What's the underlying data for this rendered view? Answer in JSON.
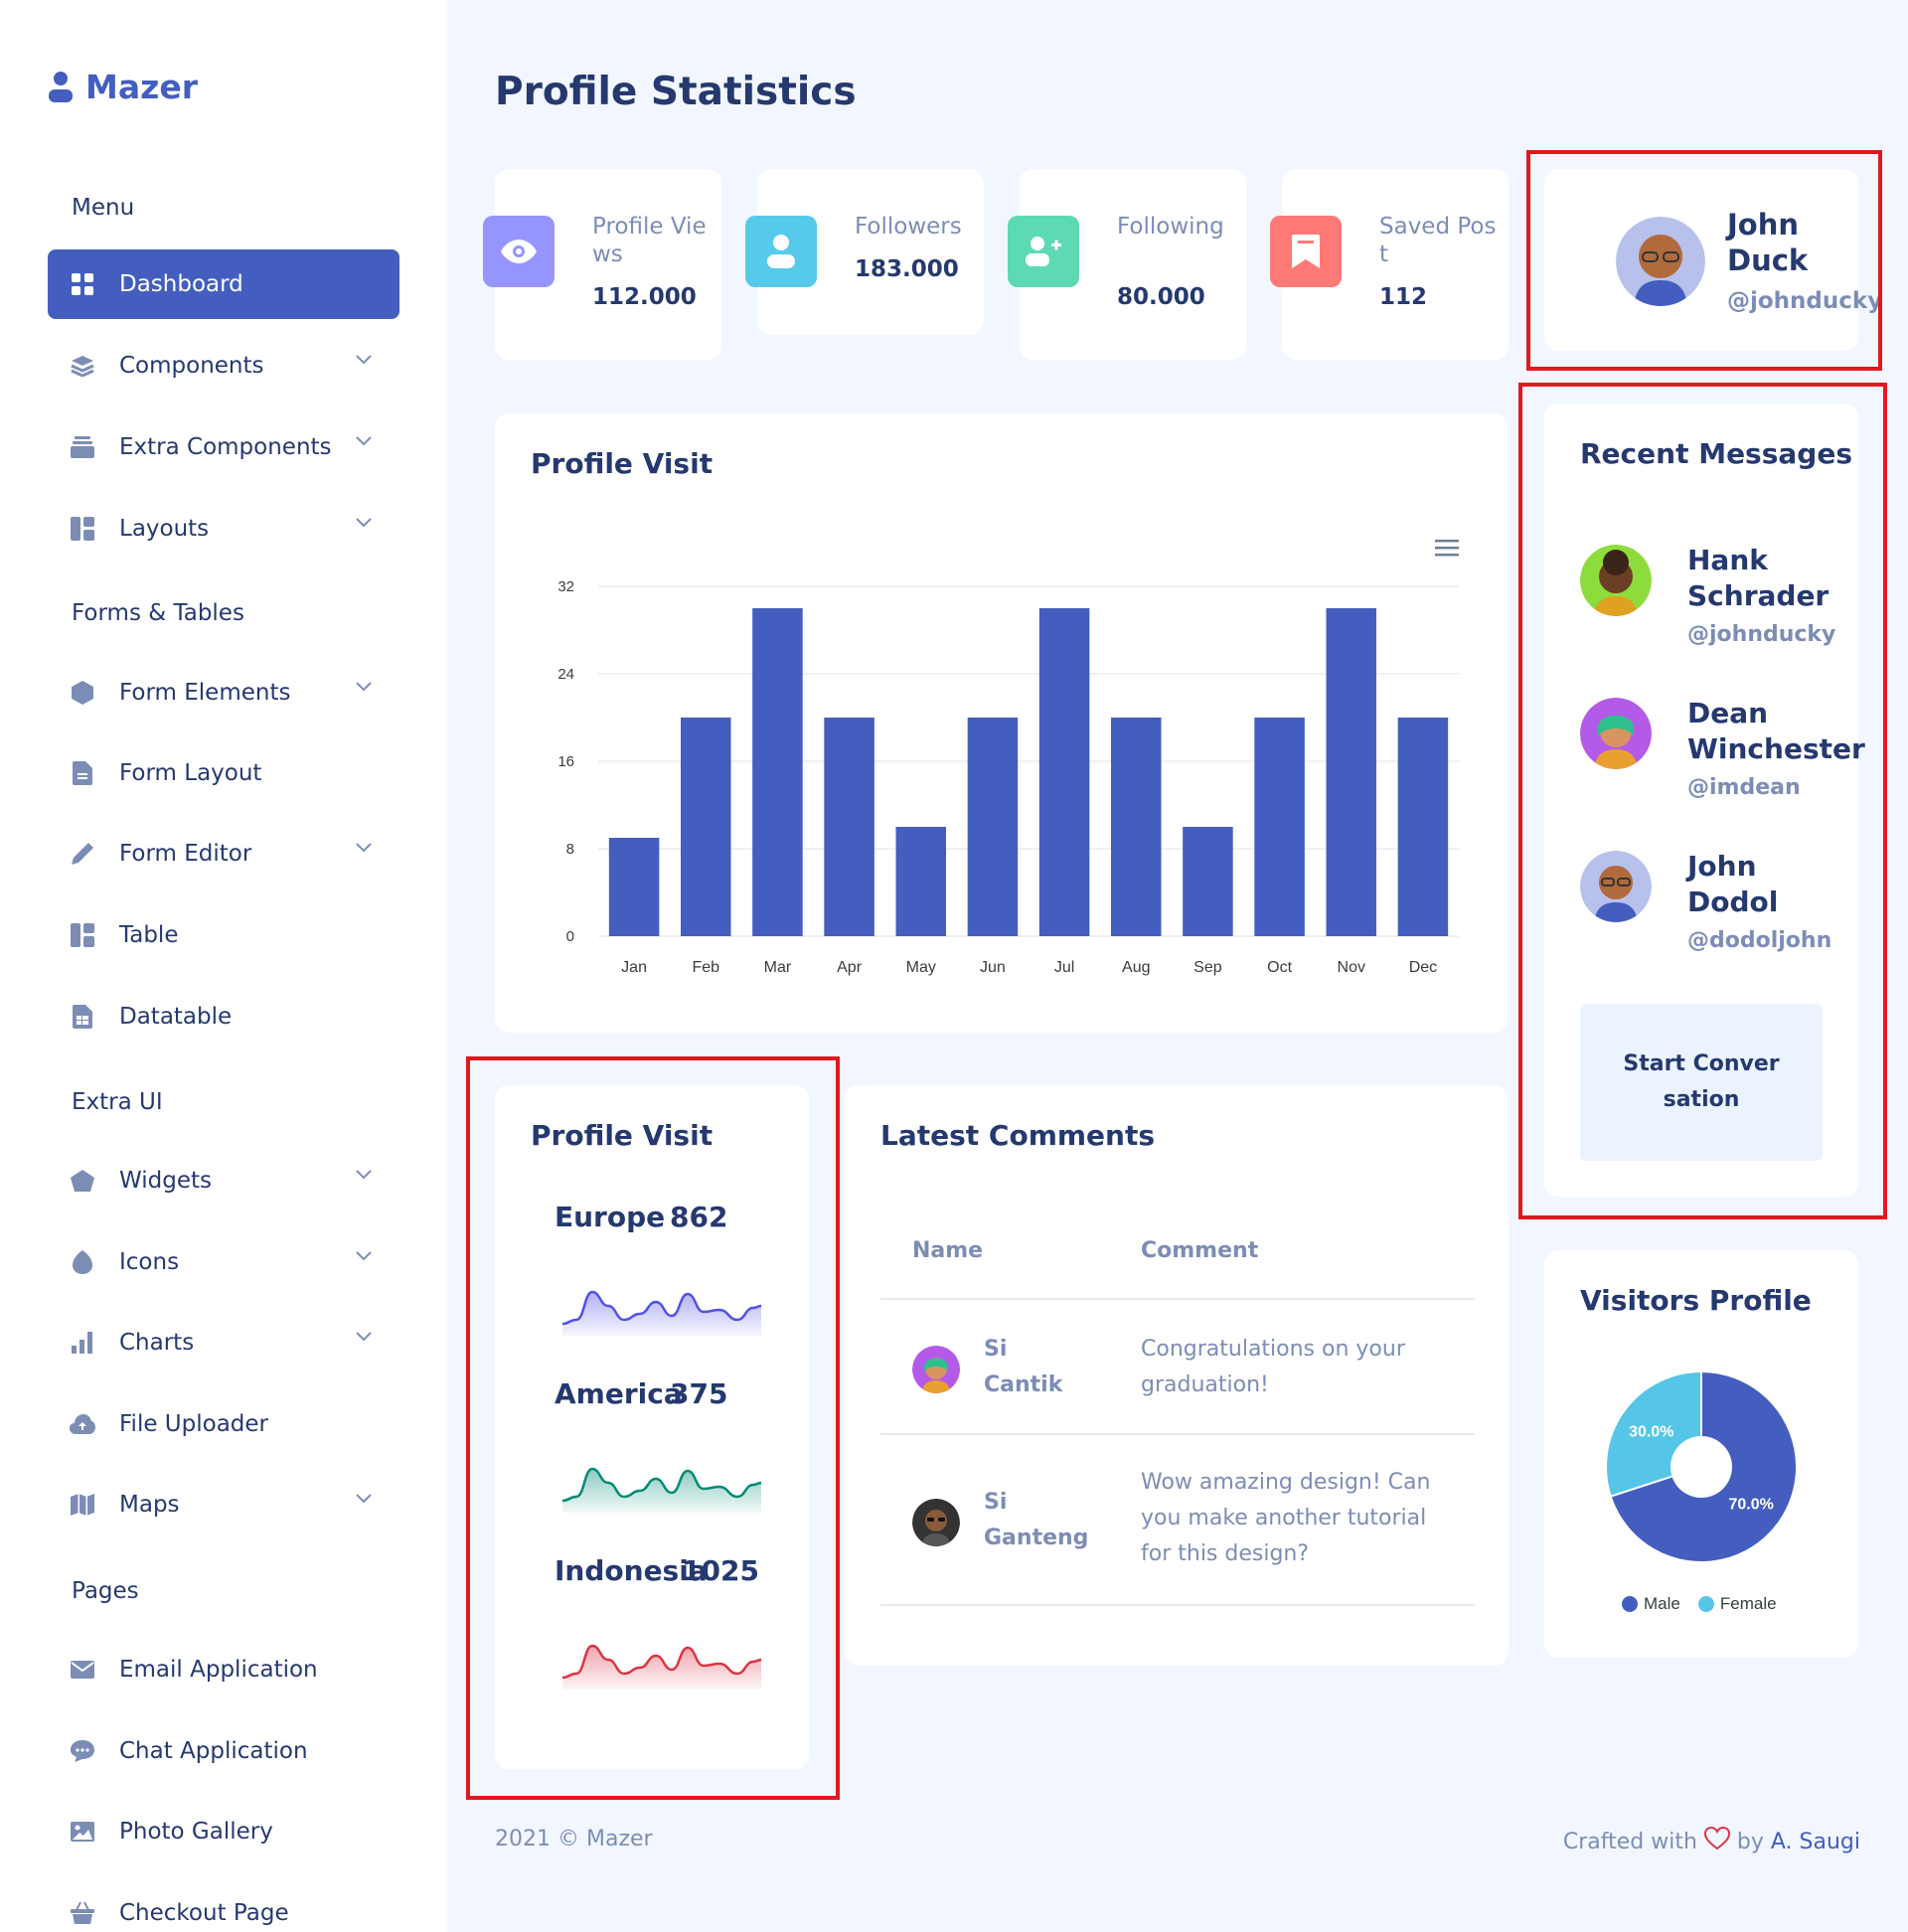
{
  "sidebar": {
    "logo": "Mazer",
    "sections": {
      "menu": "Menu",
      "forms": "Forms & Tables",
      "extra": "Extra UI",
      "pages": "Pages"
    },
    "items": [
      {
        "label": "Dashboard",
        "icon": "grid-icon"
      },
      {
        "label": "Components",
        "icon": "stack-icon"
      },
      {
        "label": "Extra Components",
        "icon": "collection-icon"
      },
      {
        "label": "Layouts",
        "icon": "layout-icon"
      },
      {
        "label": "Form Elements",
        "icon": "hexagon-icon"
      },
      {
        "label": "Form Layout",
        "icon": "file-text-icon"
      },
      {
        "label": "Form Editor",
        "icon": "pen-icon"
      },
      {
        "label": "Table",
        "icon": "table-icon"
      },
      {
        "label": "Datatable",
        "icon": "spreadsheet-icon"
      },
      {
        "label": "Widgets",
        "icon": "pentagon-icon"
      },
      {
        "label": "Icons",
        "icon": "egg-icon"
      },
      {
        "label": "Charts",
        "icon": "bar-chart-icon"
      },
      {
        "label": "File Uploader",
        "icon": "cloud-upload-icon"
      },
      {
        "label": "Maps",
        "icon": "map-icon"
      },
      {
        "label": "Email Application",
        "icon": "envelope-icon"
      },
      {
        "label": "Chat Application",
        "icon": "chat-icon"
      },
      {
        "label": "Photo Gallery",
        "icon": "image-icon"
      },
      {
        "label": "Checkout Page",
        "icon": "basket-icon"
      }
    ]
  },
  "header": {
    "title": "Profile Statistics"
  },
  "stats": [
    {
      "label": "Profile Views",
      "value": "112.000",
      "color": "#9694ff",
      "icon": "eye-icon"
    },
    {
      "label": "Followers",
      "value": "183.000",
      "color": "#57caeb",
      "icon": "person-icon"
    },
    {
      "label": "Following",
      "value": "80.000",
      "color": "#5ddab4",
      "icon": "person-plus-icon"
    },
    {
      "label": "Saved Post",
      "value": "112",
      "color": "#ff7976",
      "icon": "bookmark-icon"
    }
  ],
  "profile": {
    "name": "John Duck",
    "handle": "@johnducky"
  },
  "profile_visit": {
    "title": "Profile Visit"
  },
  "chart_data": {
    "type": "bar",
    "categories": [
      "Jan",
      "Feb",
      "Mar",
      "Apr",
      "May",
      "Jun",
      "Jul",
      "Aug",
      "Sep",
      "Oct",
      "Nov",
      "Dec"
    ],
    "values": [
      9,
      20,
      30,
      20,
      10,
      20,
      30,
      20,
      10,
      20,
      30,
      20
    ],
    "yticks": [
      0,
      8,
      16,
      24,
      32
    ],
    "ylim": [
      0,
      32
    ],
    "color": "#435ebe",
    "grid": true
  },
  "messages": {
    "title": "Recent Messages",
    "items": [
      {
        "name": "Hank Schrader",
        "handle": "@johnducky"
      },
      {
        "name": "Dean Winchester",
        "handle": "@imdean"
      },
      {
        "name": "John Dodol",
        "handle": "@dodoljohn"
      }
    ],
    "button": "Start Conversation"
  },
  "regions": {
    "title": "Profile Visit",
    "items": [
      {
        "name": "Europe",
        "value": "862",
        "color": "#5350e9"
      },
      {
        "name": "America",
        "value": "375",
        "color": "#008b75"
      },
      {
        "name": "Indonesia",
        "value": "1025",
        "color": "#dc3545"
      }
    ]
  },
  "comments": {
    "title": "Latest Comments",
    "columns": [
      "Name",
      "Comment"
    ],
    "rows": [
      {
        "name": "Si Cantik",
        "comment": "Congratulations on your graduation!"
      },
      {
        "name": "Si Ganteng",
        "comment": "Wow amazing design! Can you make another tutorial for this design?"
      }
    ]
  },
  "visitors": {
    "title": "Visitors Profile",
    "slices": [
      {
        "label": "Male",
        "value": 70,
        "text": "70.0%",
        "color": "#435ebe"
      },
      {
        "label": "Female",
        "value": 30,
        "text": "30.0%",
        "color": "#55c6e8"
      }
    ]
  },
  "footer": {
    "left": "2021 © Mazer",
    "right_prefix": "Crafted with",
    "right_by": "by",
    "author": "A. Saugi"
  }
}
